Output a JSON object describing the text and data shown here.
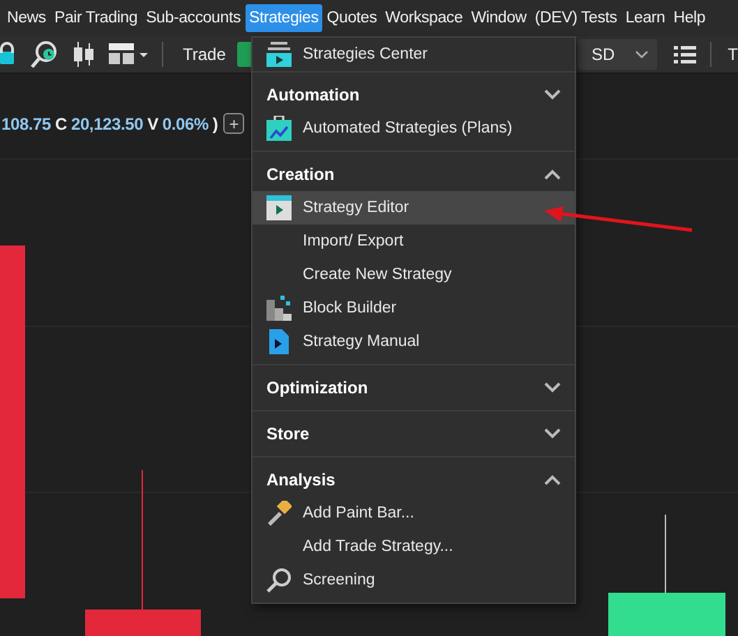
{
  "menubar": [
    {
      "label": "News",
      "selected": false
    },
    {
      "label": "Pair Trading",
      "selected": false
    },
    {
      "label": "Sub-accounts",
      "selected": false
    },
    {
      "label": "Strategies",
      "selected": true
    },
    {
      "label": "Quotes",
      "selected": false
    },
    {
      "label": "Workspace",
      "selected": false
    },
    {
      "label": "Window",
      "selected": false
    },
    {
      "label": "(DEV) Tests",
      "selected": false
    },
    {
      "label": "Learn",
      "selected": false
    },
    {
      "label": "Help",
      "selected": false
    }
  ],
  "toolbar": {
    "trade_label": "Trade",
    "currency": "SD",
    "cut_label": "T"
  },
  "quote_line": {
    "high": "108.75",
    "close_label": "C",
    "close": "20,123.50",
    "volume_label": "V",
    "change": "0.06%",
    "paren": ")",
    "add": "+"
  },
  "menu": [
    {
      "kind": "item",
      "label": "Strategies Center",
      "selected": false
    },
    {
      "kind": "section",
      "title": "Automation",
      "expanded": false,
      "items": [
        {
          "label": "Automated Strategies (Plans)",
          "selected": false
        }
      ]
    },
    {
      "kind": "section",
      "title": "Creation",
      "expanded": true,
      "items": [
        {
          "label": "Strategy Editor",
          "selected": true
        },
        {
          "label": "Import/ Export",
          "selected": false
        },
        {
          "label": "Create New Strategy",
          "selected": false
        },
        {
          "label": "Block Builder",
          "selected": false
        },
        {
          "label": "Strategy Manual",
          "selected": false
        }
      ]
    },
    {
      "kind": "section",
      "title": "Optimization",
      "expanded": false
    },
    {
      "kind": "section",
      "title": "Store",
      "expanded": false
    },
    {
      "kind": "section",
      "title": "Analysis",
      "expanded": true,
      "items": [
        {
          "label": "Add Paint Bar...",
          "selected": false
        },
        {
          "label": "Add Trade Strategy...",
          "selected": false
        },
        {
          "label": "Screening",
          "selected": false
        }
      ]
    }
  ]
}
